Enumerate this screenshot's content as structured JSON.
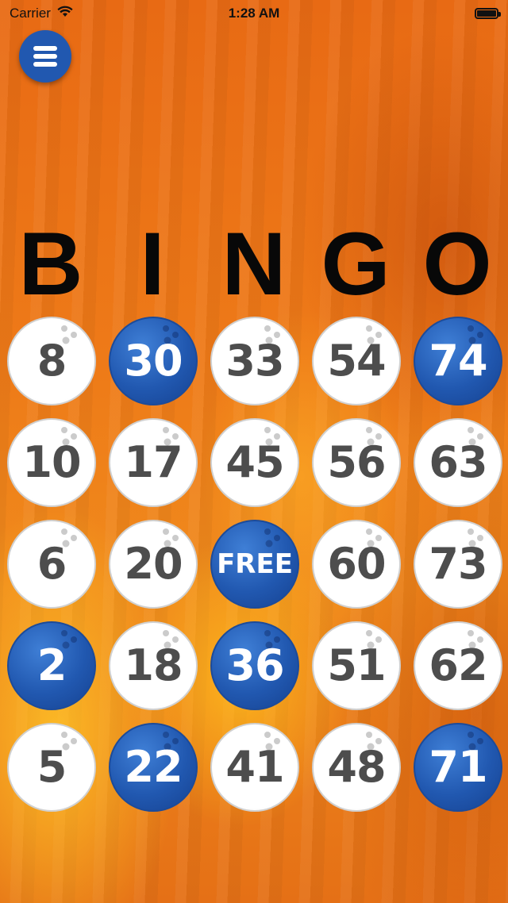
{
  "status_bar": {
    "carrier": "Carrier",
    "time": "1:28 AM"
  },
  "menu": {
    "icon": "hamburger-menu-icon",
    "color": "#2158b0"
  },
  "header": {
    "letters": [
      "B",
      "I",
      "N",
      "G",
      "O"
    ]
  },
  "card": {
    "marked_color": "#2158b0",
    "unmarked_color": "#ffffff",
    "rows": [
      [
        {
          "label": "8",
          "marked": false
        },
        {
          "label": "30",
          "marked": true
        },
        {
          "label": "33",
          "marked": false
        },
        {
          "label": "54",
          "marked": false
        },
        {
          "label": "74",
          "marked": true
        }
      ],
      [
        {
          "label": "10",
          "marked": false
        },
        {
          "label": "17",
          "marked": false
        },
        {
          "label": "45",
          "marked": false
        },
        {
          "label": "56",
          "marked": false
        },
        {
          "label": "63",
          "marked": false
        }
      ],
      [
        {
          "label": "6",
          "marked": false
        },
        {
          "label": "20",
          "marked": false
        },
        {
          "label": "FREE",
          "marked": true
        },
        {
          "label": "60",
          "marked": false
        },
        {
          "label": "73",
          "marked": false
        }
      ],
      [
        {
          "label": "2",
          "marked": true
        },
        {
          "label": "18",
          "marked": false
        },
        {
          "label": "36",
          "marked": true
        },
        {
          "label": "51",
          "marked": false
        },
        {
          "label": "62",
          "marked": false
        }
      ],
      [
        {
          "label": "5",
          "marked": false
        },
        {
          "label": "22",
          "marked": true
        },
        {
          "label": "41",
          "marked": false
        },
        {
          "label": "48",
          "marked": false
        },
        {
          "label": "71",
          "marked": true
        }
      ]
    ]
  }
}
